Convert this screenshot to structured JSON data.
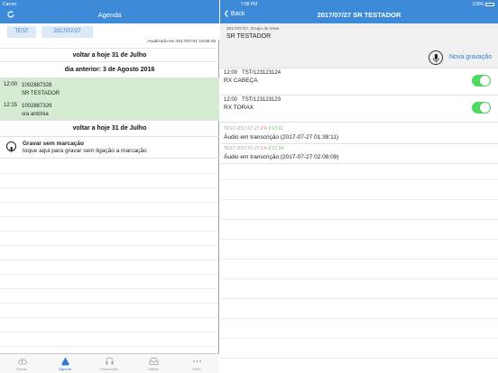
{
  "status": {
    "carrier": "Carrier",
    "time": "7:58 PM",
    "battery": "100%"
  },
  "left": {
    "title": "Agenda",
    "seg": {
      "filter": "TEST",
      "date": "2017/07/27"
    },
    "updated": "Atualizado em 2017/07/31 19:05:45",
    "voltar_top": "voltar a hoje 31 de Julho",
    "dia_anterior": "dia anterior: 3 de Agosto 2016",
    "appointments": [
      {
        "time": "12:00",
        "id": "1002887328",
        "name": "SR TESTADOR"
      },
      {
        "time": "12:15",
        "id": "1002887329",
        "name": "sra antónia"
      }
    ],
    "voltar_bottom": "voltar a hoje 31 de Julho",
    "gravar": {
      "title": "Gravar sem marcação",
      "desc": "toque aqui para gravar sem ligação a marcação"
    },
    "tabs": [
      "Enviar",
      "Agenda",
      "Transcrição",
      "Validar",
      "More"
    ]
  },
  "right": {
    "back": "Back",
    "title": "2017/07/27 SR TESTADOR",
    "sub": "2017/07/27, Grupo de teste",
    "name": "SR TESTADOR",
    "nova": "Nova gravação",
    "exams": [
      {
        "time": "12:00",
        "code": "TST/123123124",
        "label": "RX CABEÇA",
        "on": true
      },
      {
        "time": "12:00",
        "code": "TST/123123123",
        "label": "RX TORAX",
        "on": true
      }
    ],
    "audios": [
      {
        "src": "TEST 2017-07-27",
        "hours": "2 h",
        "dur": "2:17.11",
        "text": "Áudio em transcrição (2017-07-27 01:38:11)"
      },
      {
        "src": "TEST 2017-07-27",
        "hours": "2 h",
        "dur": "2:17.14",
        "text": "Áudio em transcrição (2017-07-27 02:08:09)"
      }
    ]
  }
}
